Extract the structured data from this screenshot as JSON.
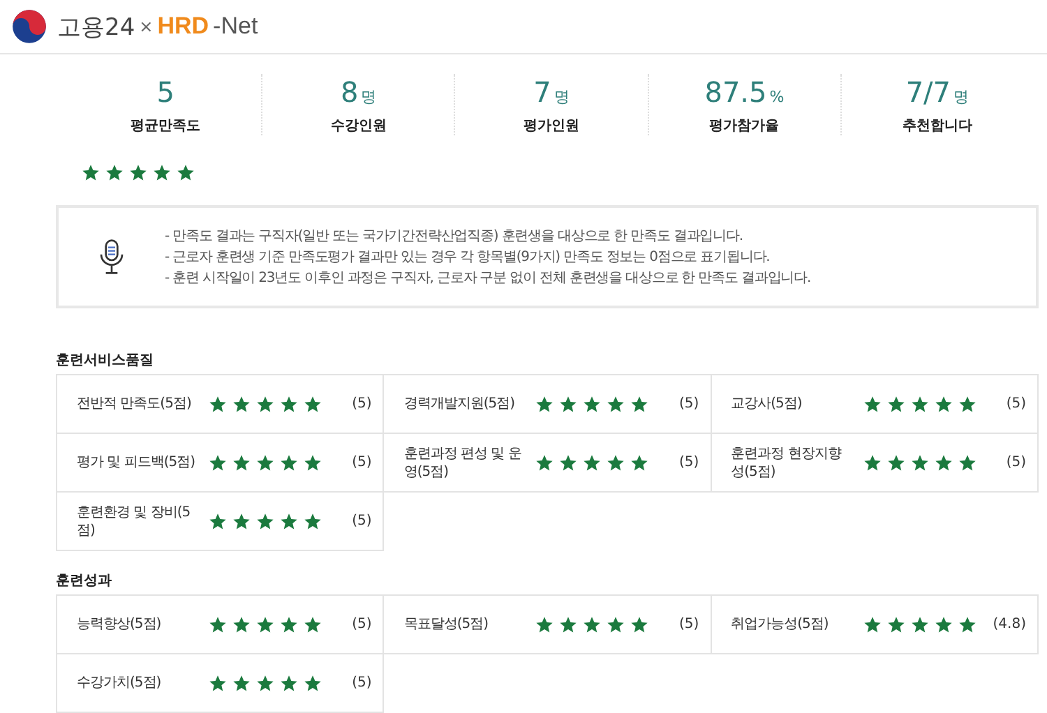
{
  "header": {
    "brand": "고용24",
    "separator": "×",
    "partner_accent": "HRD",
    "partner_rest": "-Net"
  },
  "stats": [
    {
      "value": "5",
      "label": "평균만족도"
    },
    {
      "value": "8",
      "unit": "명",
      "label": "수강인원"
    },
    {
      "value": "7",
      "unit": "명",
      "label": "평가인원"
    },
    {
      "value": "87.5",
      "unit": "%",
      "label": "평가참가율"
    },
    {
      "value": "7/7",
      "unit": "명",
      "label": "추천합니다"
    }
  ],
  "overall": {
    "stars": 5
  },
  "notice": [
    "- 만족도 결과는 구직자(일반 또는 국가기간전략산업직종) 훈련생을 대상으로 한 만족도 결과입니다.",
    "- 근로자 훈련생 기준 만족도평가 결과만 있는 경우 각 항목별(9가지) 만족도 정보는 0점으로 표기됩니다.",
    "- 훈련 시작일이 23년도 이후인 과정은 구직자, 근로자 구분 없이 전체 훈련생을 대상으로 한 만족도 결과입니다."
  ],
  "sections": [
    {
      "title": "훈련서비스품질",
      "items": [
        {
          "label": "전반적 만족도(5점)",
          "stars": 5,
          "score": "(5)"
        },
        {
          "label": "경력개발지원(5점)",
          "stars": 5,
          "score": "(5)"
        },
        {
          "label": "교강사(5점)",
          "stars": 5,
          "score": "(5)"
        },
        {
          "label": "평가 및 피드백(5점)",
          "stars": 5,
          "score": "(5)"
        },
        {
          "label": "훈련과정 편성 및 운영(5점)",
          "stars": 5,
          "score": "(5)"
        },
        {
          "label": "훈련과정 현장지향성(5점)",
          "stars": 5,
          "score": "(5)"
        },
        {
          "label": "훈련환경 및 장비(5점)",
          "stars": 5,
          "score": "(5)"
        }
      ]
    },
    {
      "title": "훈련성과",
      "items": [
        {
          "label": "능력향상(5점)",
          "stars": 5,
          "score": "(5)"
        },
        {
          "label": "목표달성(5점)",
          "stars": 5,
          "score": "(5)"
        },
        {
          "label": "취업가능성(5점)",
          "stars": 5,
          "score": "(4.8)"
        },
        {
          "label": "수강가치(5점)",
          "stars": 5,
          "score": "(5)"
        }
      ]
    }
  ]
}
